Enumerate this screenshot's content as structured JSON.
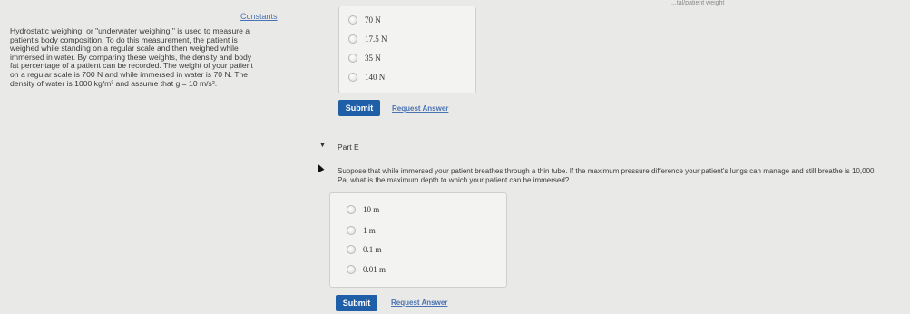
{
  "left": {
    "constants_link": "Constants",
    "problem_lines": [
      "Hydrostatic weighing, or \"underwater weighing,\" is used to measure a",
      "patient's body composition. To do this measurement, the patient is",
      "weighed while standing on a regular scale and then weighed while",
      "immersed in water. By comparing these weights, the density and body",
      "fat percentage of a patient can be recorded. The weight of your patient",
      "on a regular scale is 700 N and while immersed in water is 70 N. The",
      "density of water is 1000 kg/m³ and assume that g = 10 m/s²."
    ]
  },
  "part_d": {
    "options": [
      "70 N",
      "17.5 N",
      "35 N",
      "140 N"
    ],
    "submit_label": "Submit",
    "request_label": "Request Answer"
  },
  "part_e": {
    "title": "Part E",
    "question_line1": "Suppose that while immersed your patient breathes through a thin tube. If the maximum pressure difference your patient's lungs can manage and still breathe is 10,000",
    "question_line2": "Pa, what is the maximum depth to which your patient can be immersed?",
    "options": [
      "10 m",
      "1 m",
      "0.1 m",
      "0.01 m"
    ],
    "submit_label": "Submit",
    "request_label": "Request Answer"
  },
  "top_fragment": "...tal/patient weight"
}
